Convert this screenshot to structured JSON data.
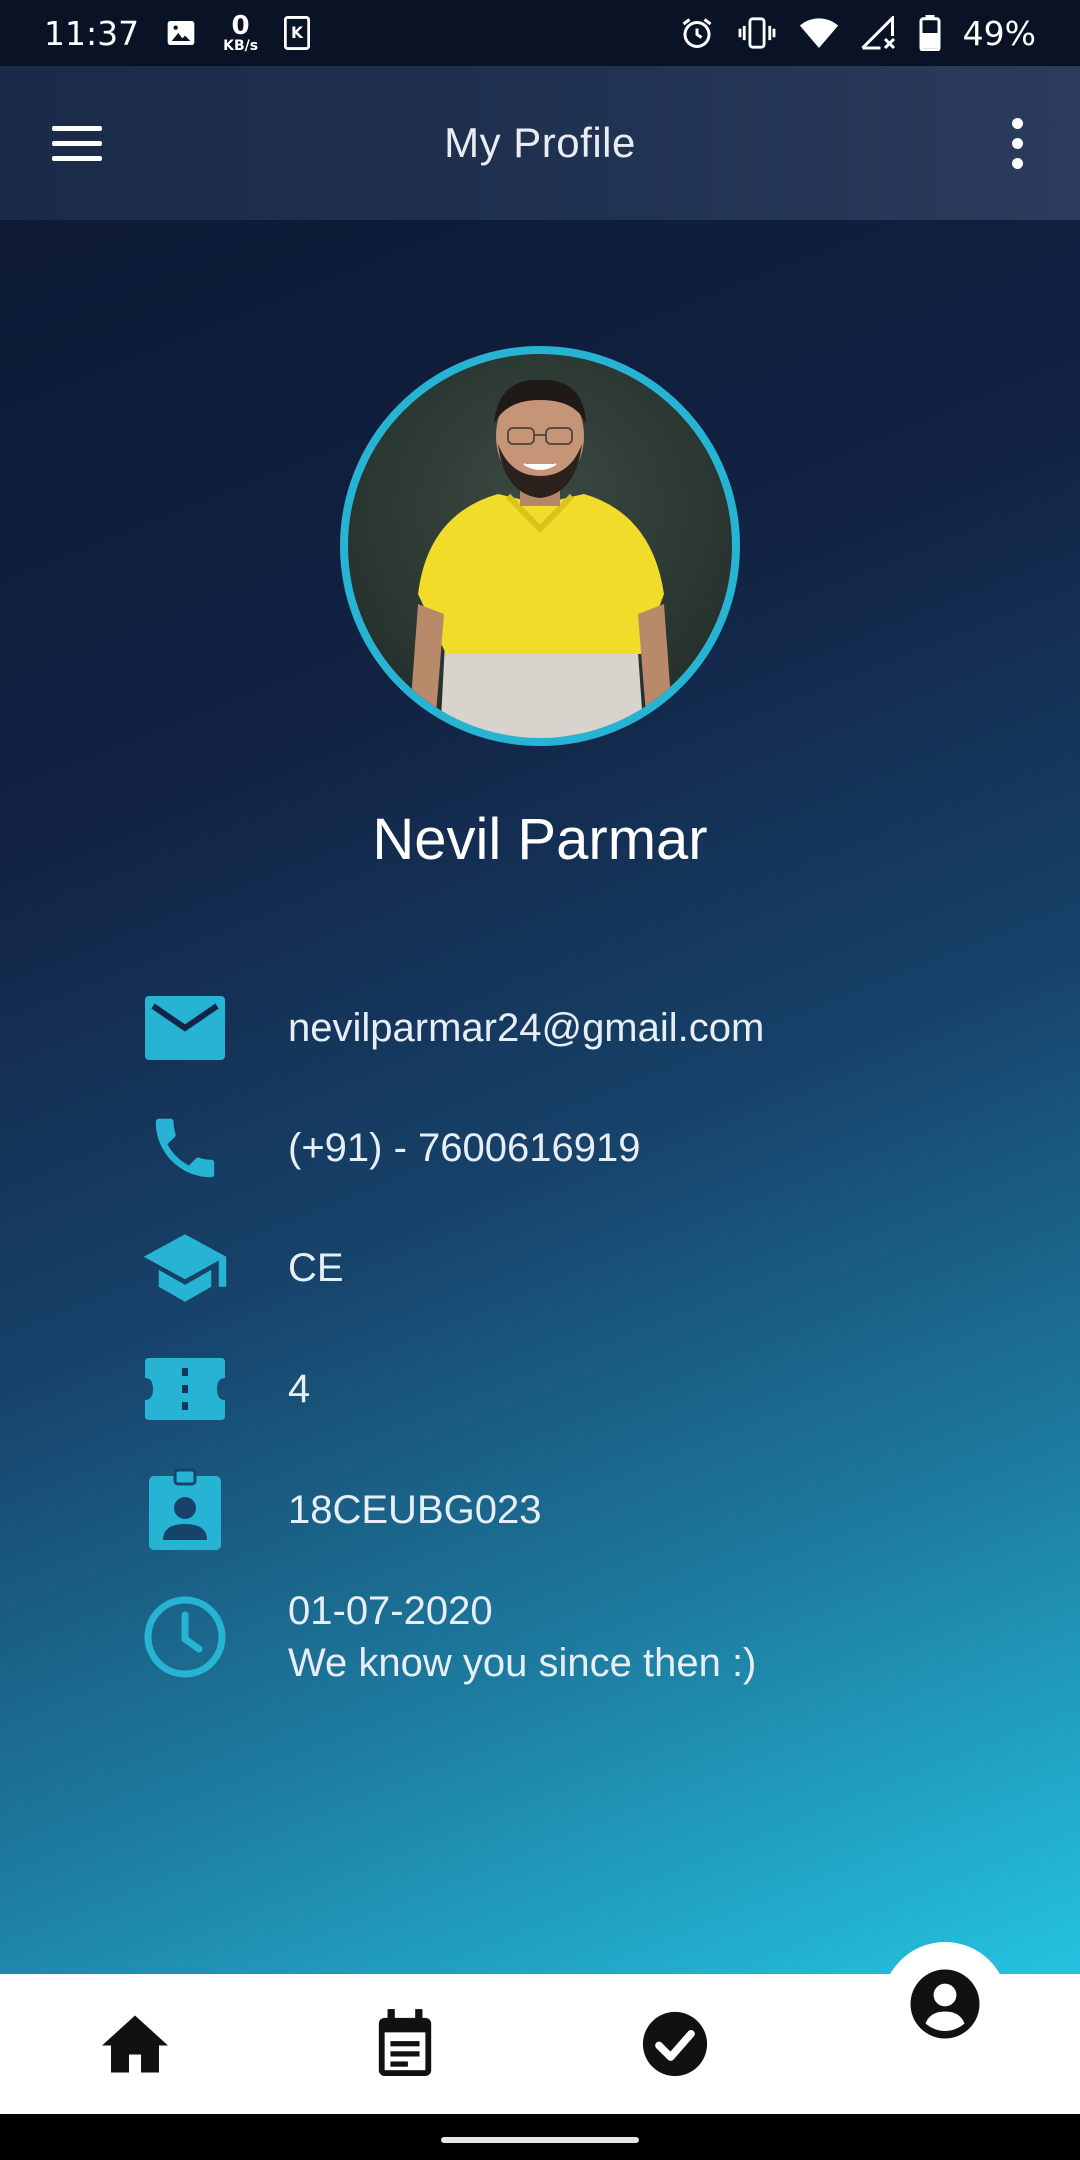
{
  "status_bar": {
    "time": "11:37",
    "net_speed_value": "0",
    "net_speed_unit": "KB/s",
    "battery": "49%",
    "icons": [
      "image-icon",
      "kindle-icon",
      "alarm-icon",
      "vibrate-icon",
      "wifi-icon",
      "signal-icon",
      "battery-icon"
    ]
  },
  "appbar": {
    "title": "My Profile",
    "menu_icon": "hamburger-menu-icon",
    "overflow_icon": "more-vert-icon"
  },
  "profile": {
    "name": "Nevil Parmar",
    "avatar": "profile-photo"
  },
  "details": {
    "email": "nevilparmar24@gmail.com",
    "phone": "(+91) - 7600616919",
    "branch": "CE",
    "semester": "4",
    "enrollment": "18CEUBG023",
    "joined_date": "01-07-2020",
    "joined_note": "We know you since then :)"
  },
  "bottom_nav": {
    "items": [
      {
        "icon": "home-icon"
      },
      {
        "icon": "calendar-icon"
      },
      {
        "icon": "check-circle-icon"
      },
      {
        "icon": "account-icon",
        "active": true
      }
    ]
  },
  "colors": {
    "accent": "#27b4d4",
    "appbar": "#213352",
    "background_top": "#0c1730",
    "background_bottom": "#24c3e1"
  }
}
